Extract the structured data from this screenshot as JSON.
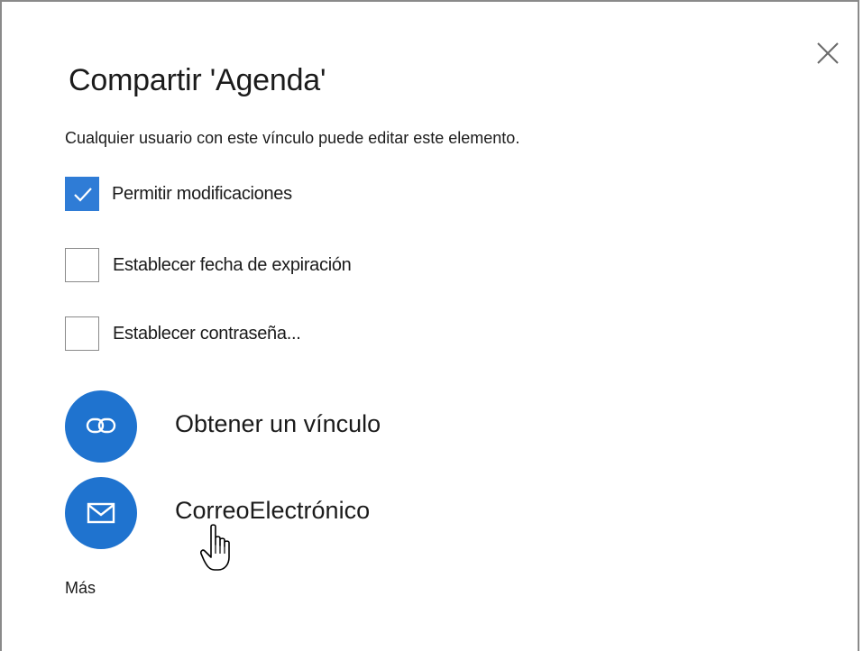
{
  "dialog": {
    "title": "Compartir 'Agenda'",
    "description": "Cualquier usuario con este vínculo puede editar este elemento.",
    "close_icon": "close-icon"
  },
  "options": [
    {
      "label": "Permitir modificaciones",
      "checked": true
    },
    {
      "label": "Establecer fecha de expiración",
      "checked": false
    },
    {
      "label": "Establecer contraseña...",
      "checked": false
    }
  ],
  "actions": [
    {
      "label": "Obtener un vínculo",
      "icon": "link-icon"
    },
    {
      "label": "CorreoElectrónico",
      "icon": "mail-icon"
    }
  ],
  "more_label": "Más",
  "colors": {
    "accent": "#1f73cf",
    "checkbox_checked": "#2f7cd6"
  }
}
